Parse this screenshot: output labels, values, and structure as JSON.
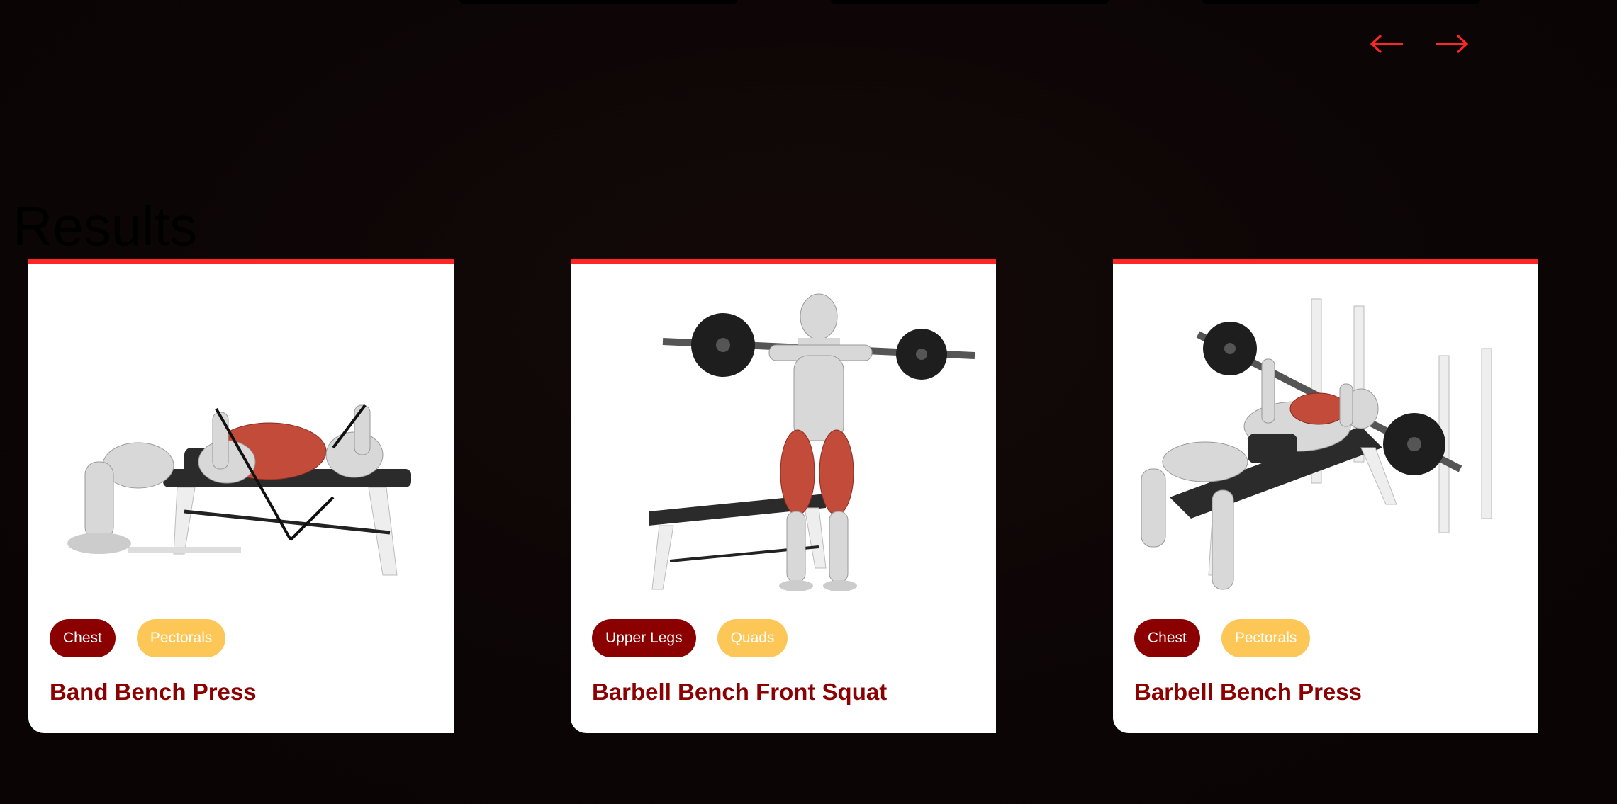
{
  "carousel": {
    "prev_arrow": "←",
    "next_arrow": "→",
    "arrow_color": "#ff2625"
  },
  "results": {
    "heading": "Results",
    "cards": [
      {
        "image_icon": "band-bench-press-illustration",
        "body_part": "Chest",
        "target": "Pectorals",
        "name": "Band Bench Press"
      },
      {
        "image_icon": "barbell-bench-front-squat-illustration",
        "body_part": "Upper Legs",
        "target": "Quads",
        "name": "Barbell Bench Front Squat"
      },
      {
        "image_icon": "barbell-bench-press-illustration",
        "body_part": "Chest",
        "target": "Pectorals",
        "name": "Barbell Bench Press"
      }
    ]
  },
  "colors": {
    "background": "#0d0606",
    "card_border_top": "#ff2625",
    "body_part_tag": "#8b0000",
    "target_tag": "#fcc757",
    "title": "#8b0000"
  }
}
